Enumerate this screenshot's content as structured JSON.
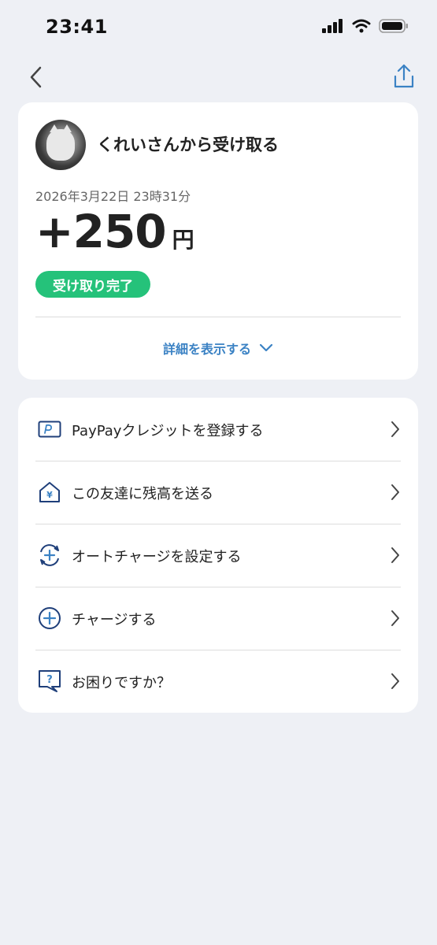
{
  "status_bar": {
    "time": "23:41"
  },
  "transaction": {
    "title": "くれいさんから受け取る",
    "datetime": "2026年3月22日 23時31分",
    "amount": "+250",
    "currency": "円",
    "status": "受け取り完了",
    "details_label": "詳細を表示する"
  },
  "menu": {
    "items": [
      {
        "label": "PayPayクレジットを登録する",
        "icon": "credit-card-icon"
      },
      {
        "label": "この友達に残高を送る",
        "icon": "house-yen-icon"
      },
      {
        "label": "オートチャージを設定する",
        "icon": "auto-charge-icon"
      },
      {
        "label": "チャージする",
        "icon": "plus-circle-icon"
      },
      {
        "label": "お困りですか？",
        "icon": "help-question-icon"
      }
    ]
  },
  "colors": {
    "accent_blue": "#3b82c4",
    "status_green": "#25c27a",
    "icon_navy": "#1f3f7a",
    "background": "#eef0f5"
  }
}
